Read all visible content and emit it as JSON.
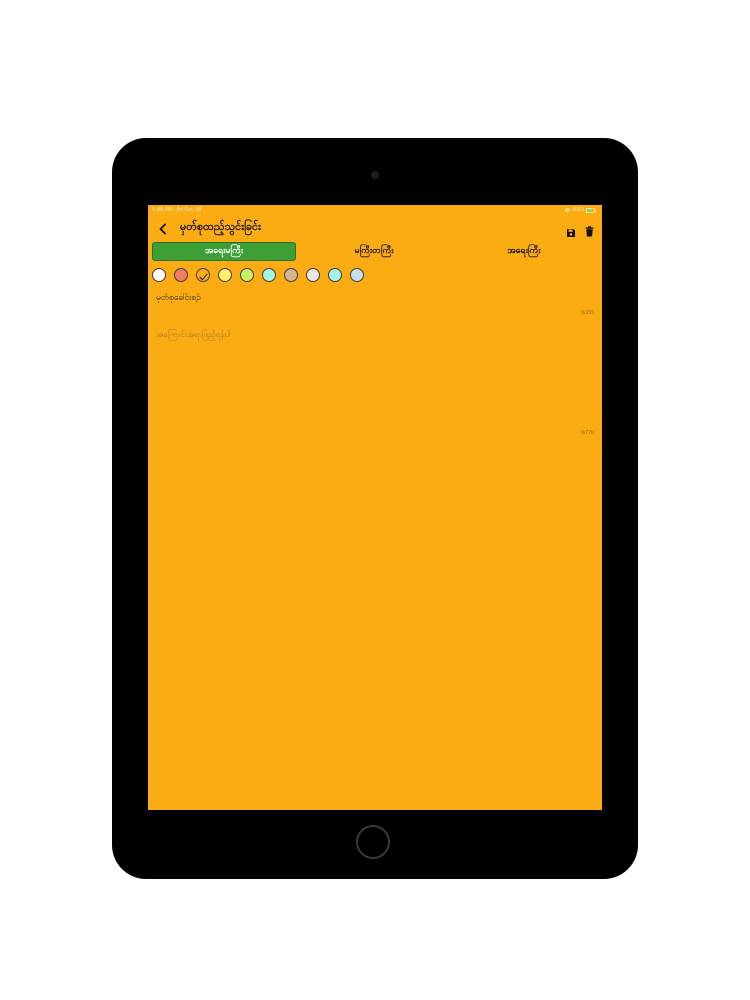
{
  "status_bar": {
    "time": "5:08 PM · Fri Oct 18",
    "battery": "63%"
  },
  "header": {
    "title": "မှတ်စုထည့်သွင်းခြင်း",
    "back_icon": "chevron-left-icon",
    "save_icon": "save-icon",
    "delete_icon": "trash-icon"
  },
  "segments": [
    {
      "label": "အရေးမကြီး",
      "active": true
    },
    {
      "label": "မကြီးတကြီး",
      "active": false
    },
    {
      "label": "အရေးကြီး",
      "active": false
    }
  ],
  "colors": {
    "background": "#FCAC13",
    "active_segment": "#3E9F36",
    "swatches": [
      "#FFFFFF",
      "#F07C68",
      "#FCAC13",
      "#FFF26A",
      "#C7F064",
      "#A5F5E2",
      "#D9B58E",
      "#ECE7E5",
      "#A4F3F0",
      "#C4E0EA"
    ],
    "selected_swatch_index": 2
  },
  "form": {
    "title_placeholder": "မှတ်စုခေါင်းစဉ်",
    "title_count": "0/255",
    "body_placeholder": "အကြောင်းအရာဖြည့်ရန်ပါ",
    "body_count": "0/770"
  }
}
